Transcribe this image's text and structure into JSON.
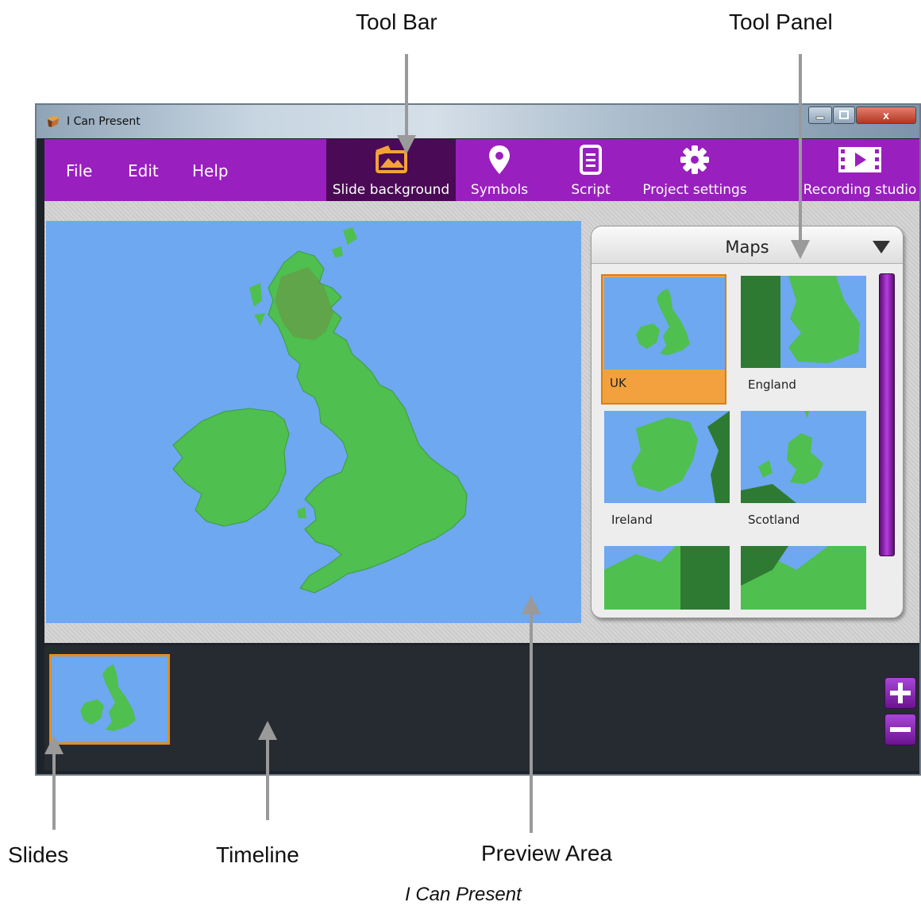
{
  "annotations": {
    "tool_bar": "Tool Bar",
    "tool_panel": "Tool Panel",
    "slides": "Slides",
    "timeline": "Timeline",
    "preview_area": "Preview Area"
  },
  "caption": "I Can Present",
  "window": {
    "title": "I Can Present",
    "close_glyph": "x"
  },
  "menu": {
    "items": [
      "File",
      "Edit",
      "Help"
    ]
  },
  "toolbar": {
    "tools": [
      {
        "label": "Slide background",
        "icon": "slide-background-icon",
        "active": true
      },
      {
        "label": "Symbols",
        "icon": "map-pin-icon",
        "active": false
      },
      {
        "label": "Script",
        "icon": "script-icon",
        "active": false
      },
      {
        "label": "Project settings",
        "icon": "gear-icon",
        "active": false
      },
      {
        "label": "Recording studio",
        "icon": "film-icon",
        "active": false
      }
    ]
  },
  "panel": {
    "title": "Maps",
    "items": [
      {
        "label": "UK",
        "selected": true
      },
      {
        "label": "England",
        "selected": false
      },
      {
        "label": "Ireland",
        "selected": false
      },
      {
        "label": "Scotland",
        "selected": false
      },
      {
        "label": "",
        "selected": false
      },
      {
        "label": "",
        "selected": false
      }
    ]
  },
  "colors": {
    "toolbar": "#9a1fbf",
    "active_tool": "#4a0a55",
    "sea": "#6da8f0",
    "land": "#4fbf4f",
    "selection": "#f3a13f",
    "timeline": "#262b31"
  }
}
